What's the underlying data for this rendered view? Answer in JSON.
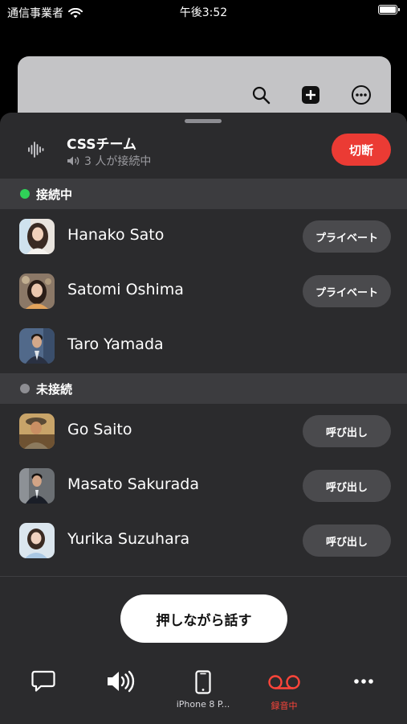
{
  "status_bar": {
    "carrier": "通信事業者",
    "time": "午後3:52"
  },
  "call": {
    "team_name": "CSSチーム",
    "status": "3 人が接続中",
    "hangup_label": "切断"
  },
  "sections": {
    "connected": {
      "label": "接続中",
      "color": "#30d158"
    },
    "disconnected": {
      "label": "未接続",
      "color": "#8e8e93"
    }
  },
  "connected_members": [
    {
      "name": "Hanako Sato",
      "action": "プライベート"
    },
    {
      "name": "Satomi Oshima",
      "action": "プライベート"
    },
    {
      "name": "Taro Yamada",
      "action": ""
    }
  ],
  "disconnected_members": [
    {
      "name": "Go Saito",
      "action": "呼び出し"
    },
    {
      "name": "Masato Sakurada",
      "action": "呼び出し"
    },
    {
      "name": "Yurika Suzuhara",
      "action": "呼び出し"
    }
  ],
  "push_to_talk_label": "押しながら話す",
  "toolbar": {
    "chat": {
      "icon": "chat-bubble-icon",
      "label": ""
    },
    "speaker": {
      "icon": "speaker-icon",
      "label": ""
    },
    "device": {
      "icon": "iphone-icon",
      "label": "iPhone 8 P..."
    },
    "recording": {
      "icon": "voicemail-icon",
      "label": "録音中",
      "color": "#ff453a"
    },
    "more": {
      "icon": "more-icon",
      "label": ""
    }
  },
  "colors": {
    "accent_red": "#eb3b34",
    "sheet_bg": "#2b2b2d"
  }
}
